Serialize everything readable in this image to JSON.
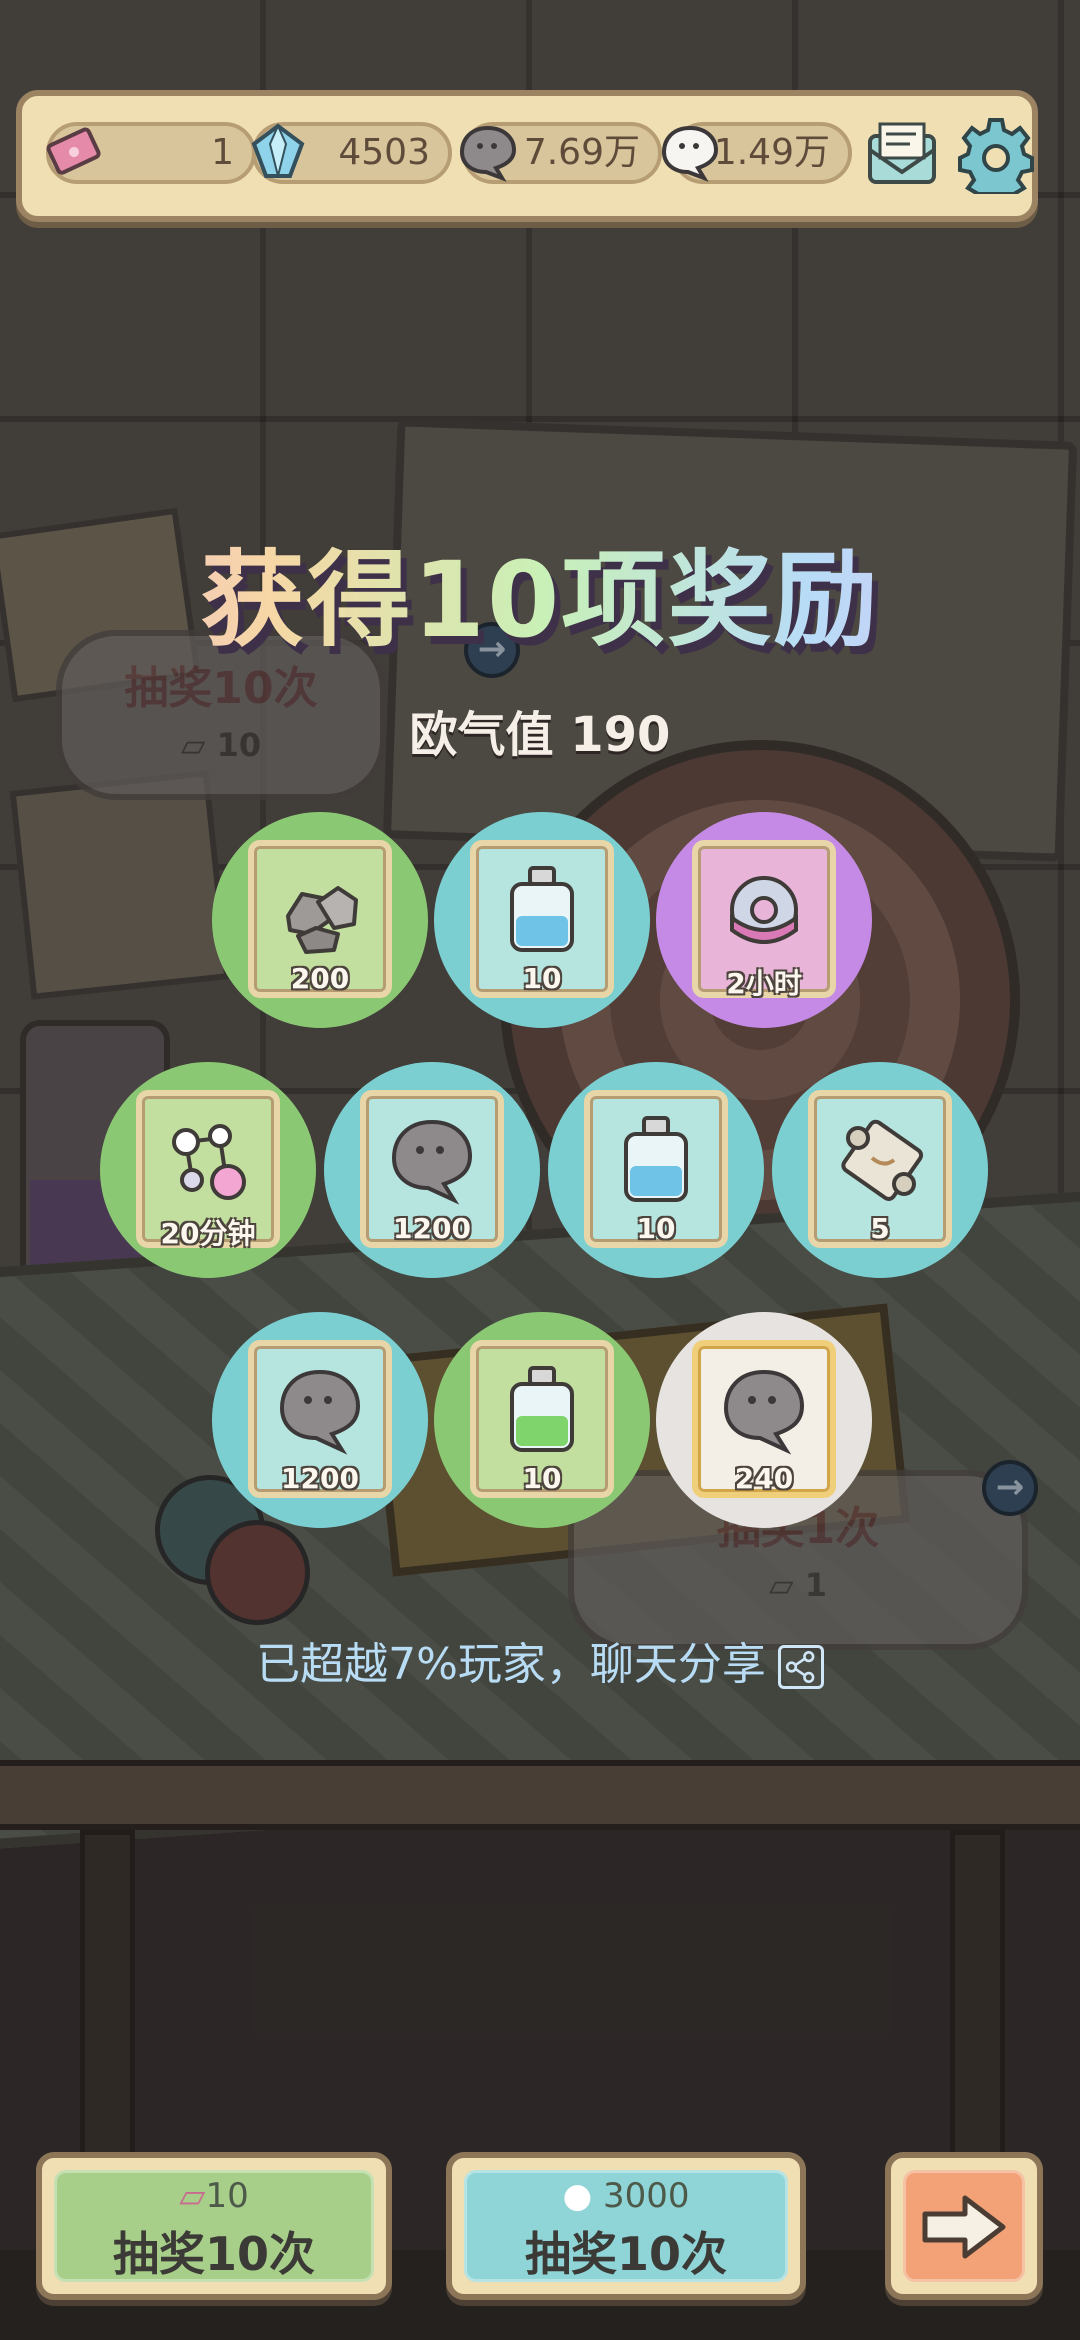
{
  "resources": {
    "ticket": {
      "value": "1",
      "icon": "ticket-icon"
    },
    "crystal": {
      "value": "4503",
      "icon": "crystal-icon"
    },
    "gray_bubble": {
      "value": "7.69万",
      "icon": "gray-bubble-icon"
    },
    "white_bubble": {
      "value": "1.49万",
      "icon": "white-bubble-icon"
    }
  },
  "title": "获得10项奖励",
  "luck_text": "欧气值 190",
  "background_buttons": {
    "draw10": {
      "label": "抽奖10次",
      "cost": "10"
    },
    "draw1": {
      "label": "抽奖1次",
      "cost": "1"
    }
  },
  "rewards": [
    {
      "icon": "stone-icon",
      "amount": "200",
      "rarity": "green"
    },
    {
      "icon": "blue-potion-icon",
      "amount": "10",
      "rarity": "teal"
    },
    {
      "icon": "gear-icon",
      "amount": "2小时",
      "rarity": "purple"
    },
    {
      "icon": "molecule-icon",
      "amount": "20分钟",
      "rarity": "green"
    },
    {
      "icon": "gray-bubble-icon",
      "amount": "1200",
      "rarity": "teal"
    },
    {
      "icon": "blue-potion-icon",
      "amount": "10",
      "rarity": "teal"
    },
    {
      "icon": "scroll-icon",
      "amount": "5",
      "rarity": "teal"
    },
    {
      "icon": "gray-bubble-icon",
      "amount": "1200",
      "rarity": "teal"
    },
    {
      "icon": "green-potion-icon",
      "amount": "10",
      "rarity": "green"
    },
    {
      "icon": "gray-bubble-icon",
      "amount": "240",
      "rarity": "white"
    }
  ],
  "share_text": "已超越7%玩家，聊天分享",
  "bottom_buttons": {
    "draw_ticket": {
      "cost": "10",
      "label": "抽奖10次"
    },
    "draw_bubble": {
      "cost": "3000",
      "label": "抽奖10次"
    },
    "next": {
      "icon": "arrow-right-icon"
    }
  },
  "colors": {
    "green": "#8bc874",
    "teal": "#7ccfd1",
    "purple": "#c589e6",
    "white": "#e6e3e0"
  }
}
